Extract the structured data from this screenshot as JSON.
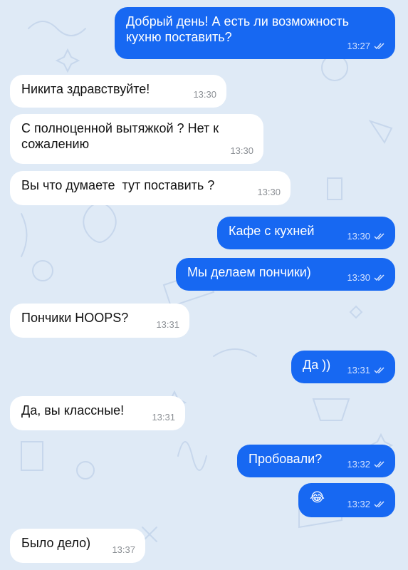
{
  "colors": {
    "background": "#dfeaf6",
    "incoming_bubble": "#ffffff",
    "outgoing_bubble": "#1768f2"
  },
  "messages": [
    {
      "dir": "out",
      "text": "Добрый день! А есть ли возможность\nкухню поставить?",
      "time": "13:27"
    },
    {
      "dir": "in",
      "text": "Никита здравствуйте!",
      "time": "13:30"
    },
    {
      "dir": "in",
      "text": "С полноценной вытяжкой ? Нет к\nсожалению",
      "time": "13:30"
    },
    {
      "dir": "in",
      "text": "Вы что думаете  тут поставить ?",
      "time": "13:30"
    },
    {
      "dir": "out",
      "text": "Кафе с кухней",
      "time": "13:30"
    },
    {
      "dir": "out",
      "text": "Мы делаем пончики)",
      "time": "13:30"
    },
    {
      "dir": "in",
      "text": "Пончики HOOPS?",
      "time": "13:31"
    },
    {
      "dir": "out",
      "text": "Да ))",
      "time": "13:31"
    },
    {
      "dir": "in",
      "text": "Да, вы классные!",
      "time": "13:31"
    },
    {
      "dir": "out",
      "text": "Пробовали?",
      "time": "13:32"
    },
    {
      "dir": "out",
      "text": "😂",
      "time": "13:32"
    },
    {
      "dir": "in",
      "text": "Было дело)",
      "time": "13:37"
    }
  ],
  "icons": {
    "read_status": "double-check-icon"
  }
}
